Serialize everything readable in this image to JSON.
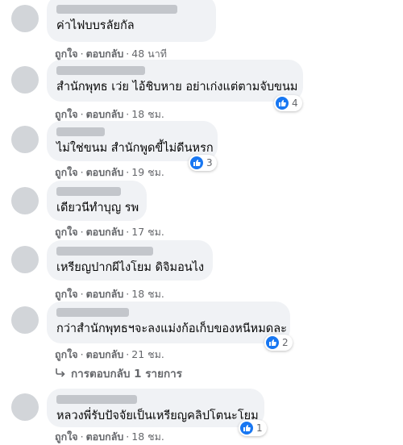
{
  "comments": [
    {
      "text": "ค่าไฟบบรลัยกัล",
      "like": "ถูกใจ",
      "reply": "ตอบกลับ",
      "time": "48 นาที",
      "reactions": ""
    },
    {
      "text": "สำนักพุทธ เว่ย ไอ้ชิบหาย อย่าเก่งแต่ตามจับขนม",
      "like": "ถูกใจ",
      "reply": "ตอบกลับ",
      "time": "18 ชม.",
      "reactions": "4"
    },
    {
      "text": "ไม่ใช่ขนม สำนักพูดขี้ไม่ดีนหรก",
      "like": "ถูกใจ",
      "reply": "ตอบกลับ",
      "time": "19 ชม.",
      "reactions": "3"
    },
    {
      "text": "เดียวนีทำบุญ รพ",
      "like": "ถูกใจ",
      "reply": "ตอบกลับ",
      "time": "17 ชม.",
      "reactions": ""
    },
    {
      "text": "เหรียญปากผีไงโยม ดิจิมอนไง",
      "like": "ถูกใจ",
      "reply": "ตอบกลับ",
      "time": "18 ชม.",
      "reactions": ""
    },
    {
      "text": "กว่าสำนักพุทธฯจะลงแม่งก้อเก็บของหนีหมดละ",
      "like": "ถูกใจ",
      "reply": "ตอบกลับ",
      "time": "21 ชม.",
      "reactions": "2"
    },
    {
      "text": "หลวงพี่รับปัจจัยเป็นเหรียญคลิปโตนะโยม",
      "like": "ถูกใจ",
      "reply": "ตอบกลับ",
      "time": "18 ชม.",
      "reactions": "1"
    }
  ],
  "replies_link": "การตอบกลับ 1 รายการ",
  "separator": "·"
}
